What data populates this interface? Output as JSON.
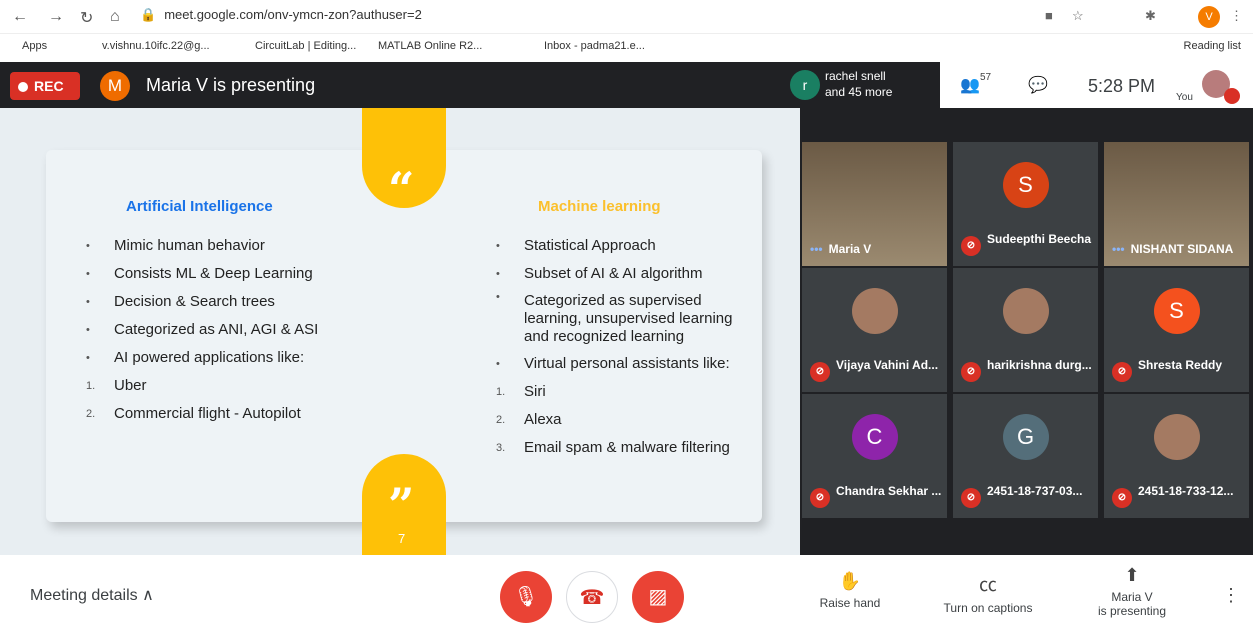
{
  "browser": {
    "url": "meet.google.com/onv-ymcn-zon?authuser=2",
    "avatar_letter": "V",
    "bookmarks": [
      "Apps",
      "v.vishnu.10ifc.22@g...",
      "CircuitLab | Editing...",
      "MATLAB Online R2...",
      "Inbox - padma21.e..."
    ],
    "reading_list": "Reading list"
  },
  "meet": {
    "rec_label": "REC",
    "presenter_letter": "M",
    "presenting_title": "Maria V is presenting",
    "participants_summary": "rachel snell\nand 45 more",
    "participant_letter": "r",
    "participant_count": "57",
    "clock": "5:28 PM",
    "self_label": "You"
  },
  "slide": {
    "left_title": "Artificial Intelligence",
    "right_title": "Machine learning",
    "page_number": "7",
    "left_items": [
      {
        "mark": "•",
        "text": "Mimic human behavior"
      },
      {
        "mark": "•",
        "text": "Consists ML & Deep Learning"
      },
      {
        "mark": "•",
        "text": "Decision & Search trees"
      },
      {
        "mark": "•",
        "text": "Categorized as ANI, AGI & ASI"
      },
      {
        "mark": "•",
        "text": "AI powered applications like:"
      },
      {
        "mark": "1.",
        "text": "Uber"
      },
      {
        "mark": "2.",
        "text": "Commercial flight - Autopilot"
      }
    ],
    "right_items": [
      {
        "mark": "•",
        "text": "Statistical Approach"
      },
      {
        "mark": "•",
        "text": "Subset of AI & AI algorithm"
      },
      {
        "mark": "•",
        "text": "Categorized as supervised learning, unsupervised learning and recognized learning"
      },
      {
        "mark": "•",
        "text": "Virtual personal assistants like:"
      },
      {
        "mark": "1.",
        "text": "Siri"
      },
      {
        "mark": "2.",
        "text": "Alexa"
      },
      {
        "mark": "3.",
        "text": "Email spam & malware filtering"
      }
    ]
  },
  "participants": [
    {
      "name": "Maria V",
      "letter": "",
      "color": "",
      "muted": false
    },
    {
      "name": "Sudeepthi Beecha",
      "letter": "S",
      "color": "#d84315",
      "muted": true
    },
    {
      "name": "NISHANT SIDANA",
      "letter": "",
      "color": "",
      "muted": false
    },
    {
      "name": "Vijaya Vahini Ad...",
      "letter": "",
      "color": "",
      "muted": true
    },
    {
      "name": "harikrishna durg...",
      "letter": "",
      "color": "",
      "muted": true
    },
    {
      "name": "Shresta Reddy",
      "letter": "S",
      "color": "#f4511e",
      "muted": true
    },
    {
      "name": "Chandra Sekhar ...",
      "letter": "C",
      "color": "#8e24aa",
      "muted": true
    },
    {
      "name": "2451-18-737-03...",
      "letter": "G",
      "color": "#546e7a",
      "muted": true
    },
    {
      "name": "2451-18-733-12...",
      "letter": "",
      "color": "",
      "muted": true
    }
  ],
  "bottom": {
    "meeting_details": "Meeting details",
    "raise_hand": "Raise hand",
    "captions": "Turn on captions",
    "presenting_1": "Maria V",
    "presenting_2": "is presenting"
  }
}
